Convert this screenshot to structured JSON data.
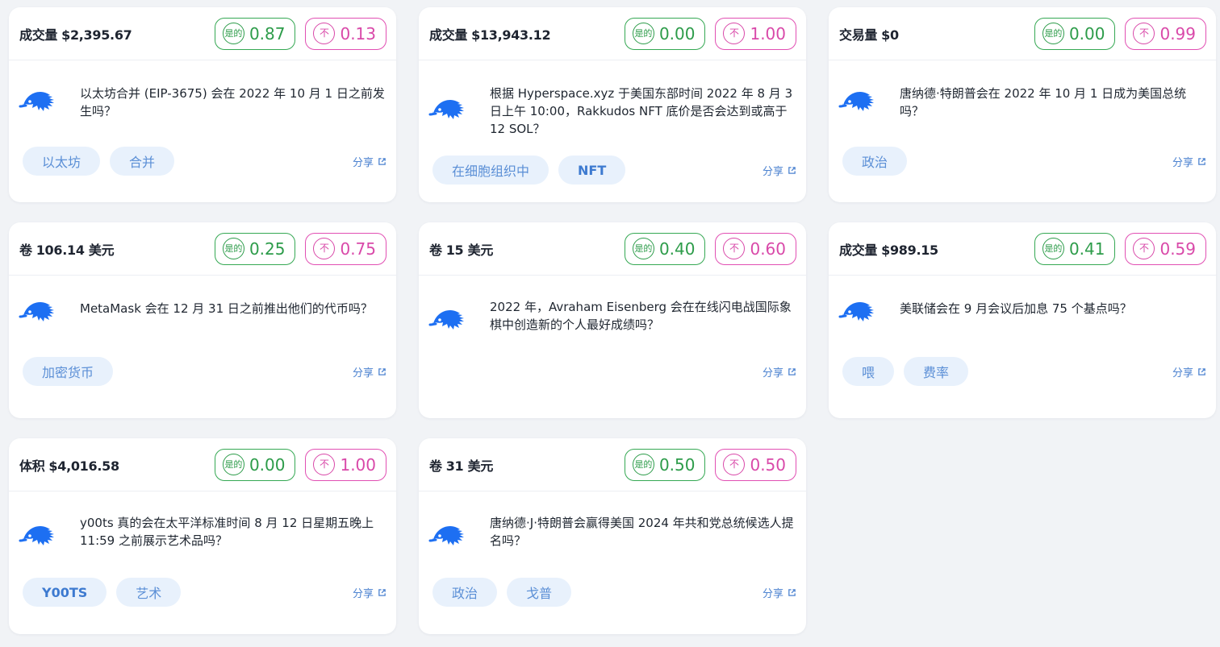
{
  "accent": "#4b82d0",
  "yes_color": "#2d9c4a",
  "no_color": "#d949a9",
  "share_label": "分享",
  "yes_badge": "是的",
  "no_badge": "不",
  "markets": [
    {
      "volume_label": "成交量",
      "volume_amount": "$2,395.67",
      "yes": "0.87",
      "no": "0.13",
      "question": "以太坊合并 (EIP-3675) 会在 2022 年 10 月 1 日之前发生吗？",
      "tags": [
        "以太坊",
        "合并"
      ]
    },
    {
      "volume_label": "成交量",
      "volume_amount": "$13,943.12",
      "yes": "0.00",
      "no": "1.00",
      "question": "根据 Hyperspace.xyz 于美国东部时间 2022 年 8 月 3 日上午 10:00，Rakkudos NFT 底价是否会达到或高于 12 SOL？",
      "tags": [
        "在细胞组织中",
        "NFT"
      ]
    },
    {
      "volume_label": "交易量",
      "volume_amount": "$0",
      "yes": "0.00",
      "no": "0.99",
      "question": "唐纳德·特朗普会在 2022 年 10 月 1 日成为美国总统吗？",
      "tags": [
        "政治"
      ]
    },
    {
      "volume_label": "卷",
      "volume_amount": "106.14 美元",
      "yes": "0.25",
      "no": "0.75",
      "question": "MetaMask 会在 12 月 31 日之前推出他们的代币吗？",
      "tags": [
        "加密货币"
      ]
    },
    {
      "volume_label": "卷",
      "volume_amount": "15 美元",
      "yes": "0.40",
      "no": "0.60",
      "question": "2022 年，Avraham Eisenberg 会在在线闪电战国际象棋中创造新的个人最好成绩吗？",
      "tags": []
    },
    {
      "volume_label": "成交量",
      "volume_amount": "$989.15",
      "yes": "0.41",
      "no": "0.59",
      "question": "美联储会在 9 月会议后加息 75 个基点吗？",
      "tags": [
        "喂",
        "费率"
      ]
    },
    {
      "volume_label": "体积",
      "volume_amount": "$4,016.58",
      "yes": "0.00",
      "no": "1.00",
      "question": "y00ts 真的会在太平洋标准时间 8 月 12 日星期五晚上 11:59 之前展示艺术品吗？",
      "tags": [
        "Y00TS",
        "艺术"
      ]
    },
    {
      "volume_label": "卷",
      "volume_amount": "31 美元",
      "yes": "0.50",
      "no": "0.50",
      "question": "唐纳德·J·特朗普会赢得美国 2024 年共和党总统候选人提名吗？",
      "tags": [
        "政治",
        "戈普"
      ]
    }
  ]
}
